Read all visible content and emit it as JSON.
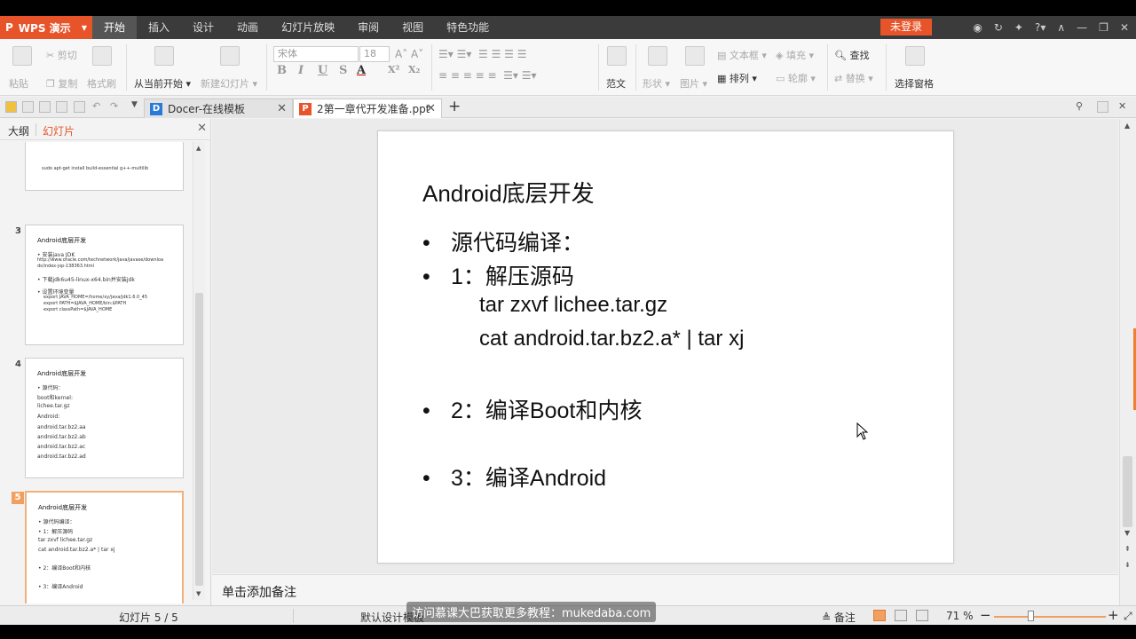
{
  "app": {
    "logo": "WPS 演示",
    "menu_tabs": [
      "开始",
      "插入",
      "设计",
      "动画",
      "幻灯片放映",
      "审阅",
      "视图",
      "特色功能"
    ],
    "login": "未登录"
  },
  "ribbon": {
    "paste": "粘贴",
    "cut": "剪切",
    "copy": "复制",
    "format_painter": "格式刷",
    "from_current": "从当前开始",
    "new_slide": "新建幻灯片",
    "font_name": "宋体",
    "font_size": "18",
    "template": "范文",
    "shape": "形状",
    "picture": "图片",
    "textbox": "文本框",
    "arrange": "排列",
    "fill": "填充",
    "outline": "轮廓",
    "find": "查找",
    "replace": "替换",
    "select_pane": "选择窗格"
  },
  "tabs": [
    {
      "label": "Docer-在线模板",
      "active": false
    },
    {
      "label": "2第一章代开发准备.ppt",
      "active": true
    }
  ],
  "left_panel": {
    "tab_outline": "大纲",
    "tab_slides": "幻灯片",
    "thumbs": [
      {
        "num": "3",
        "title": "Android底层开发",
        "lines": [
          "•  安装java JDK",
          "http://www.oracle.com/technetwork/java/javase/downloa",
          "ds/index-jsp-138363.html",
          "•  下载jdk6u45-linux-x64.bin并安装jdk",
          "•  设置环境变量",
          "export JAVA_HOME=/home/xy/java/jdk1.6.0_45",
          "export PATH=$JAVA_HOME/bin:$PATH",
          "export classPath=$JAVA_HOME"
        ]
      },
      {
        "num": "4",
        "title": "Android底层开发",
        "lines": [
          "•  源代码：",
          "   boot和kernel:",
          "            lichee.tar.gz",
          "   Android:",
          "        android.tar.bz2.aa",
          "        android.tar.bz2.ab",
          "        android.tar.bz2.ac",
          "        android.tar.bz2.ad"
        ]
      },
      {
        "num": "5",
        "title": "Android底层开发",
        "lines": [
          "•  源代码编译：",
          "•  1：解压源码",
          "      tar zxvf lichee.tar.gz",
          "      cat android.tar.bz2.a* | tar xj",
          "•  2：编译Boot和内核",
          "•  3：编译Android"
        ]
      }
    ],
    "thumb_top_partial": "sudo apt-get install build-essential g++-multilib"
  },
  "slide": {
    "title": "Android底层开发",
    "bullets": [
      "源代码编译：",
      "1：解压源码",
      "2：编译Boot和内核",
      "3：编译Android"
    ],
    "sub_lines": [
      "tar zxvf lichee.tar.gz",
      "cat android.tar.bz2.a* | tar xj"
    ],
    "bullet_char": "•"
  },
  "notes_placeholder": "单击添加备注",
  "status": {
    "slide_count": "幻灯片 5 / 5",
    "design": "默认设计模板",
    "notes_btn": "备注",
    "zoom": "71 %"
  },
  "watermark": "访问慕课大巴获取更多教程：mukedaba.com"
}
